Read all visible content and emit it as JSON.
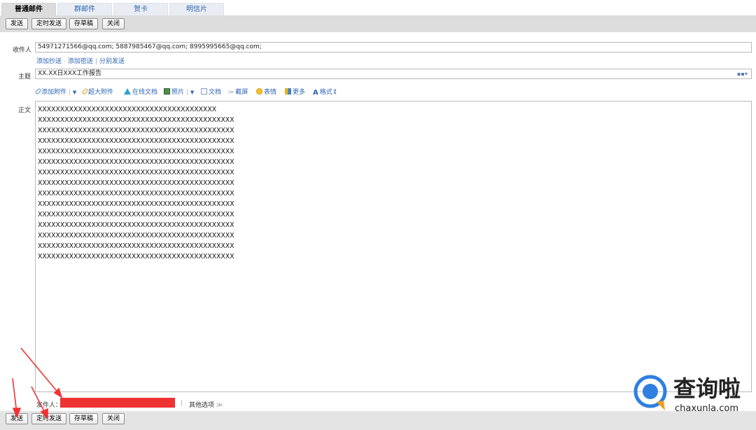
{
  "tabs": [
    {
      "label": "普通邮件",
      "active": true
    },
    {
      "label": "群邮件",
      "active": false
    },
    {
      "label": "贺卡",
      "active": false
    },
    {
      "label": "明信片",
      "active": false
    }
  ],
  "toolbar": {
    "send": "发送",
    "scheduled_send": "定时发送",
    "save_draft": "存草稿",
    "close": "关闭"
  },
  "recipient": {
    "label": "收件人",
    "value": "54971271566@qq.com;  5887985467@qq.com;  8995995665@qq.com;",
    "add_cc": "添加抄送",
    "add_bcc": "添加密送",
    "separate_send": "分别发送"
  },
  "subject": {
    "label": "主题",
    "value": "XX.XX日XXX工作报告"
  },
  "format_bar": {
    "add_attachment": "添加附件",
    "large_attachment": "超大附件",
    "online_doc": "在线文档",
    "photo": "照片",
    "document": "文档",
    "screenshot": "截屏",
    "emoji": "表情",
    "more": "更多",
    "format": "格式"
  },
  "body": {
    "label": "正文",
    "lines": [
      "XXXXXXXXXXXXXXXXXXXXXXXXXXXXXXXXXXXXXXXX",
      "XXXXXXXXXXXXXXXXXXXXXXXXXXXXXXXXXXXXXXXXXXXX",
      "XXXXXXXXXXXXXXXXXXXXXXXXXXXXXXXXXXXXXXXXXXXX",
      "XXXXXXXXXXXXXXXXXXXXXXXXXXXXXXXXXXXXXXXXXXXX",
      "XXXXXXXXXXXXXXXXXXXXXXXXXXXXXXXXXXXXXXXXXXXX",
      "XXXXXXXXXXXXXXXXXXXXXXXXXXXXXXXXXXXXXXXXXXXX",
      "XXXXXXXXXXXXXXXXXXXXXXXXXXXXXXXXXXXXXXXXXXXX",
      "XXXXXXXXXXXXXXXXXXXXXXXXXXXXXXXXXXXXXXXXXXXX",
      "XXXXXXXXXXXXXXXXXXXXXXXXXXXXXXXXXXXXXXXXXXXX",
      "XXXXXXXXXXXXXXXXXXXXXXXXXXXXXXXXXXXXXXXXXXXX",
      "XXXXXXXXXXXXXXXXXXXXXXXXXXXXXXXXXXXXXXXXXXXX",
      "XXXXXXXXXXXXXXXXXXXXXXXXXXXXXXXXXXXXXXXXXXXX",
      "XXXXXXXXXXXXXXXXXXXXXXXXXXXXXXXXXXXXXXXXXXXX",
      "XXXXXXXXXXXXXXXXXXXXXXXXXXXXXXXXXXXXXXXXXXXX",
      "XXXXXXXXXXXXXXXXXXXXXXXXXXXXXXXXXXXXXXXXXXXX"
    ]
  },
  "sender": {
    "label": "发件人：",
    "other_options": "其他选项"
  },
  "watermark": {
    "brand": "查询啦",
    "domain": "chaxunla.com"
  },
  "colors": {
    "link": "#2d64b3",
    "toolbar_bg": "#dcdcdc",
    "annotation_red": "#ef3333"
  }
}
